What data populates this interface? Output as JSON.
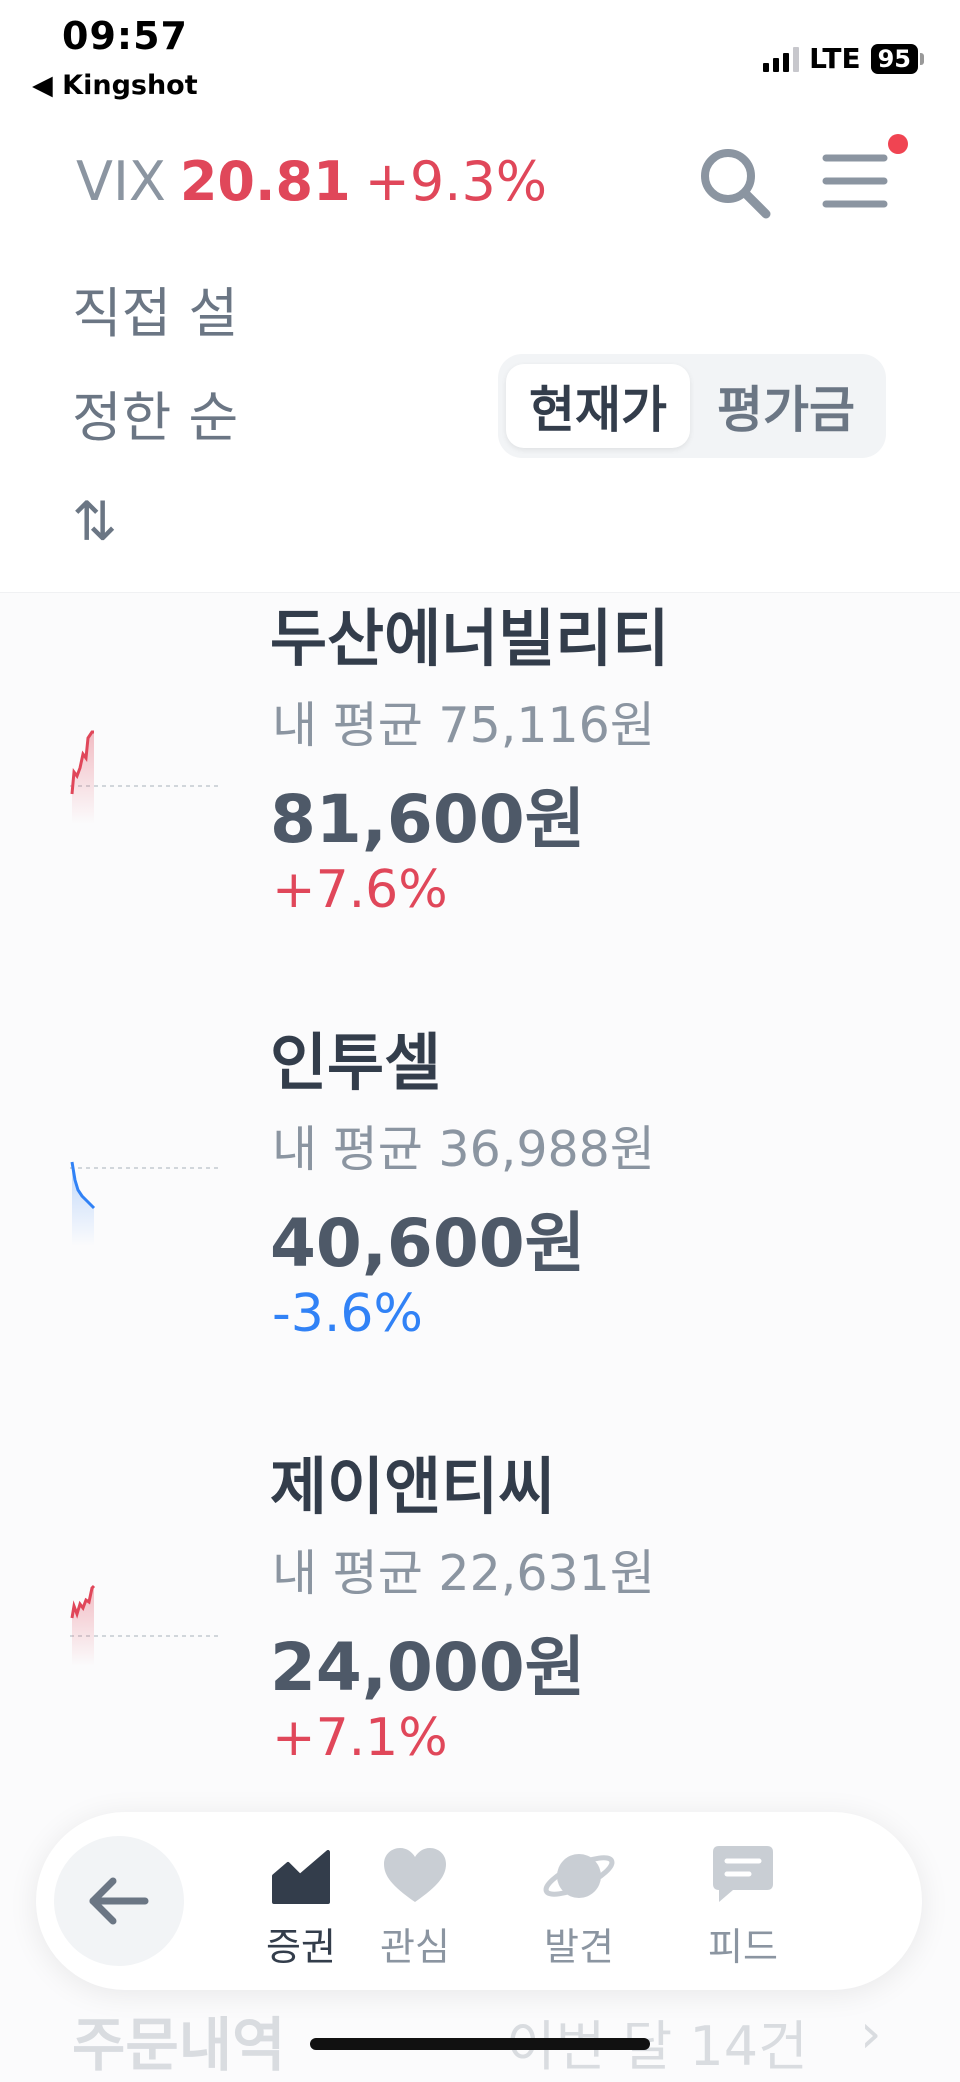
{
  "status_bar": {
    "time": "09:57",
    "back_app": "◀ Kingshot",
    "network": "LTE",
    "battery": "95"
  },
  "header": {
    "vix_label": "VIX",
    "vix_value": "20.81",
    "vix_change": "+9.3%"
  },
  "sort": {
    "label": "직접 설정한 순 ⇅"
  },
  "segment": {
    "options": [
      "현재가",
      "평가금"
    ],
    "selected": "현재가"
  },
  "stocks": [
    {
      "name": "두산에너빌리티",
      "avg": "내 평균 75,116원",
      "price": "81,600원",
      "change": "+7.6%",
      "direction": "up"
    },
    {
      "name": "인투셀",
      "avg": "내 평균 36,988원",
      "price": "40,600원",
      "change": "-3.6%",
      "direction": "down"
    },
    {
      "name": "제이앤티씨",
      "avg": "내 평균 22,631원",
      "price": "24,000원",
      "change": "+7.1%",
      "direction": "up"
    }
  ],
  "below": {
    "title": "주문내역",
    "right": "이번 달 14건",
    "chevron": "›"
  },
  "tabbar": {
    "back_icon": "arrow-left-icon",
    "tabs": [
      {
        "label": "증권",
        "icon": "chart-icon",
        "active": true
      },
      {
        "label": "관심",
        "icon": "heart-icon",
        "active": false
      },
      {
        "label": "발견",
        "icon": "planet-icon",
        "active": false
      },
      {
        "label": "피드",
        "icon": "chat-icon",
        "active": false
      }
    ]
  },
  "colors": {
    "up": "#e0475a",
    "down": "#3182f6",
    "text": "#333d4b",
    "muted": "#8b95a1"
  }
}
